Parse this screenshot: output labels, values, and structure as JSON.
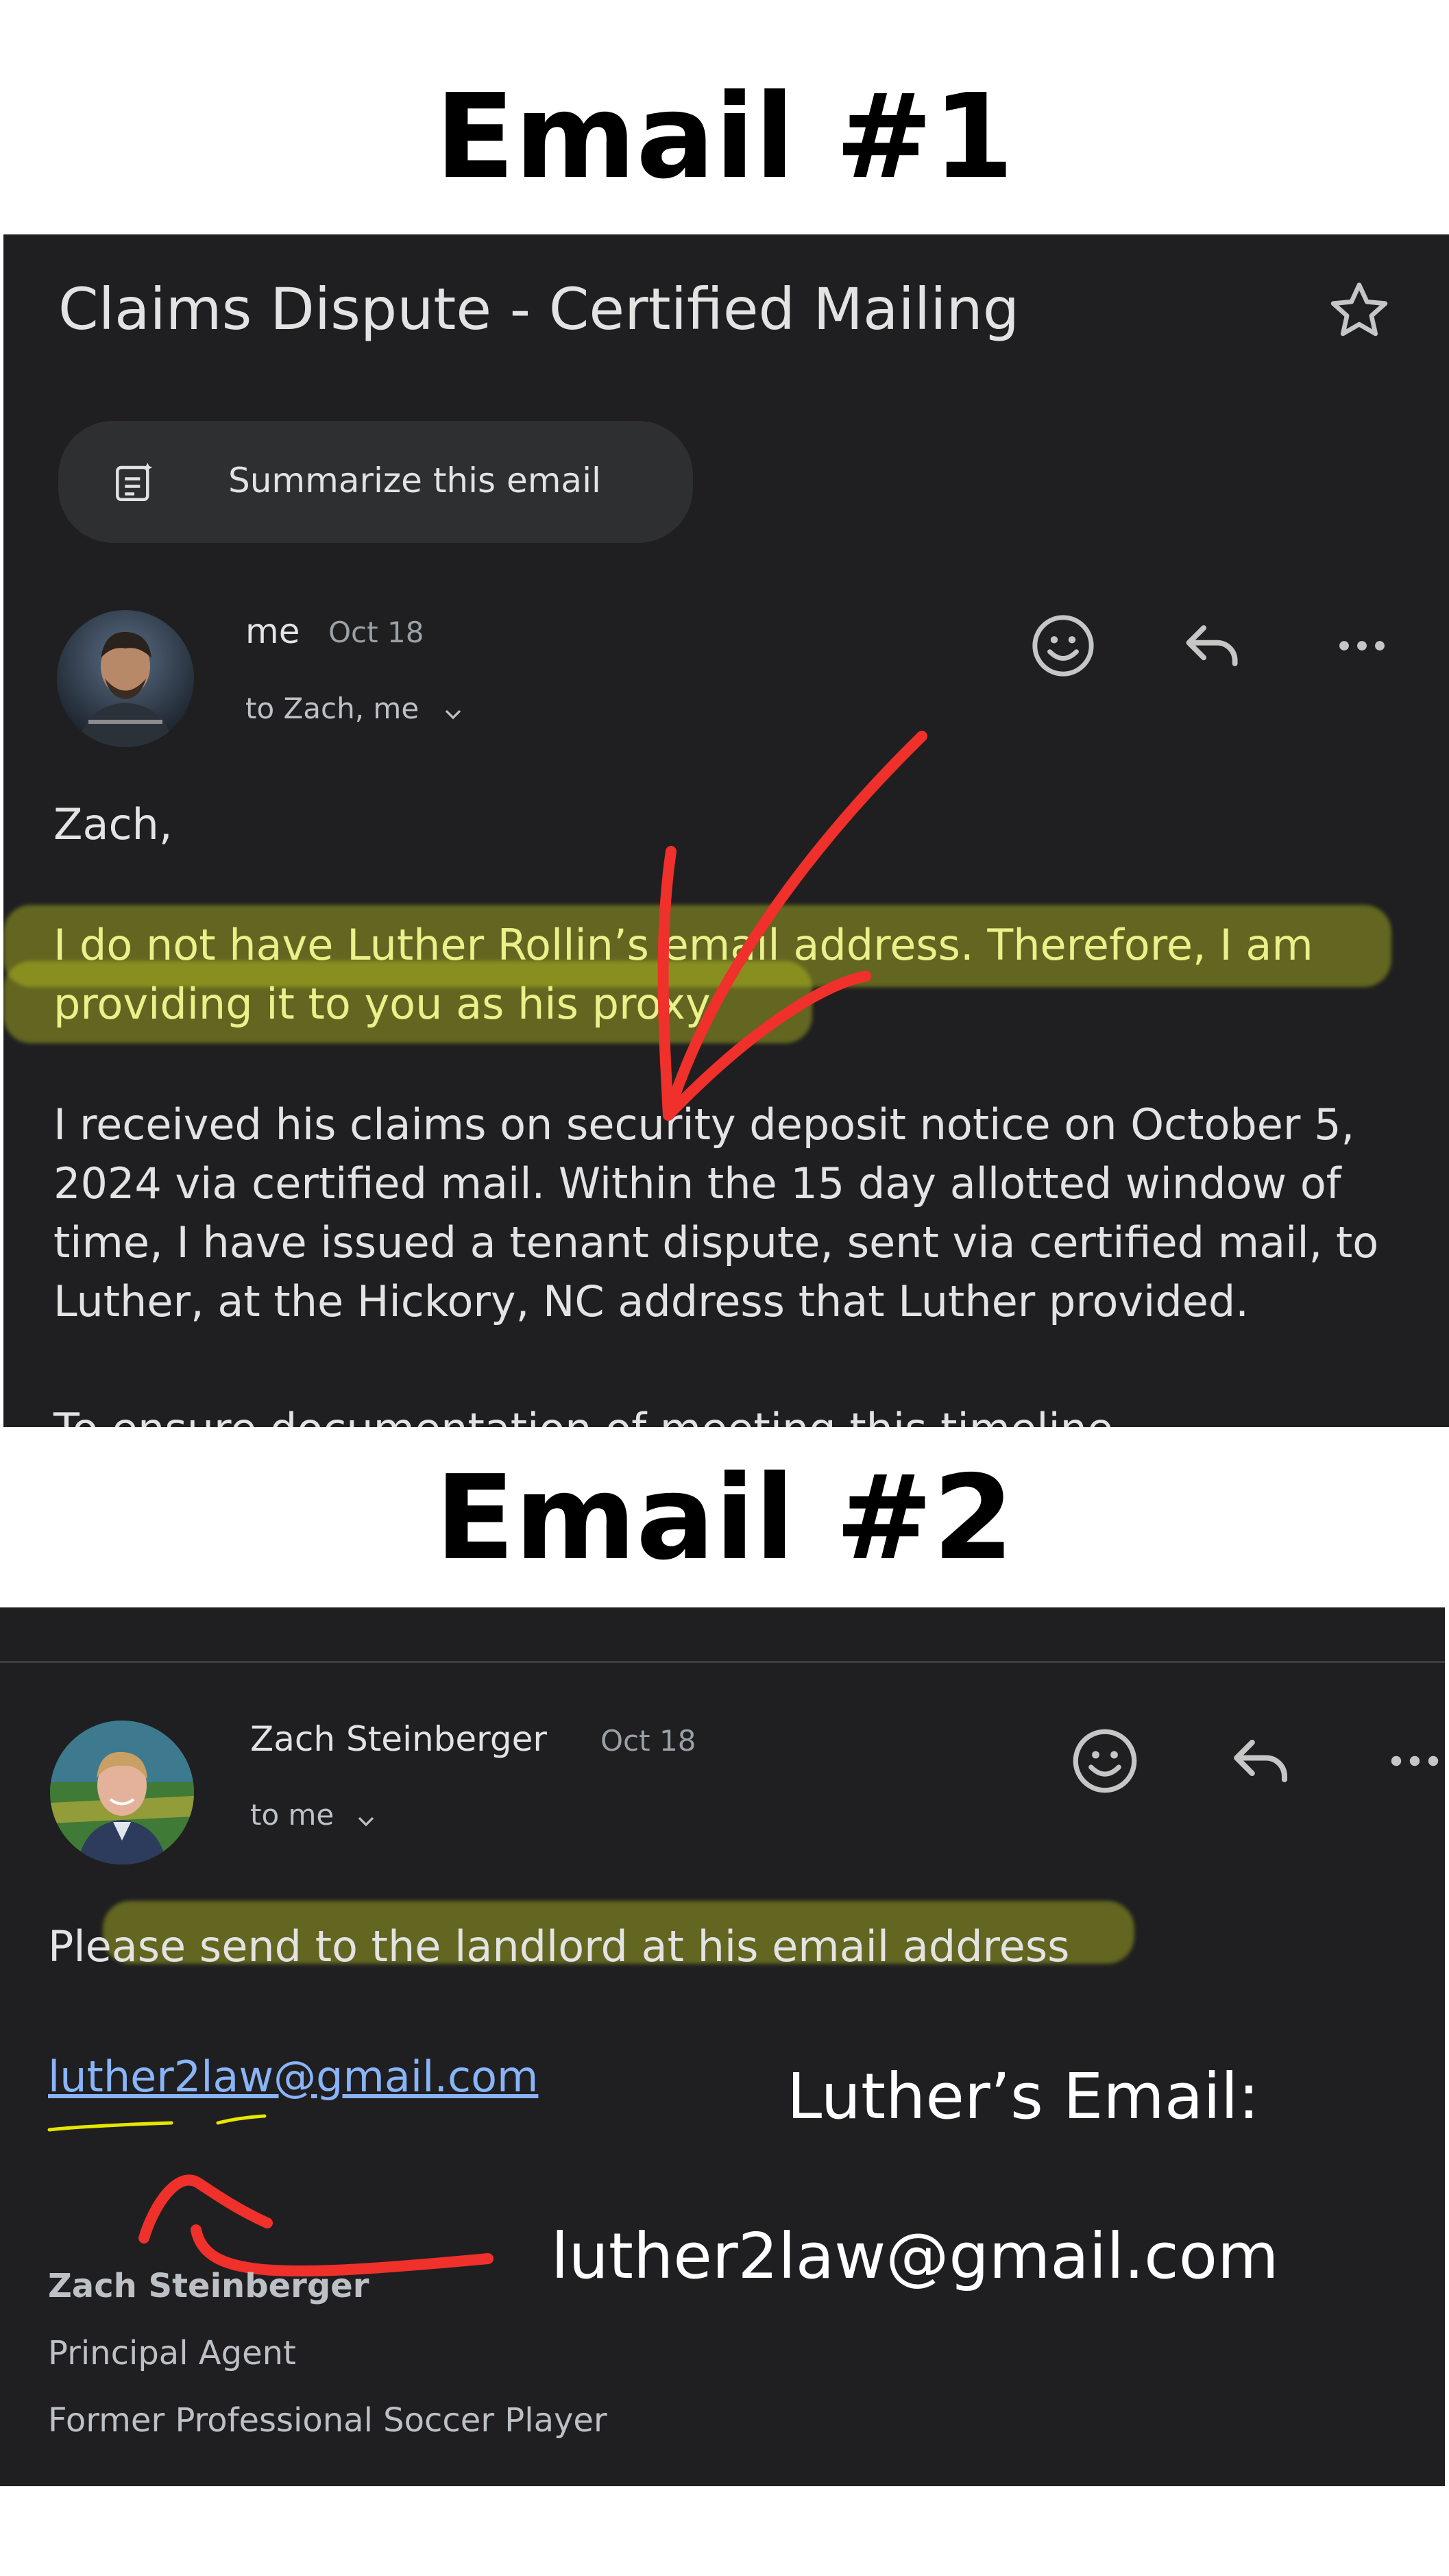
{
  "email1": {
    "heading": "Email #1",
    "subject": "Claims Dispute - Certified Mailing",
    "summarize_label": "Summarize this email",
    "sender": "me",
    "date": "Oct 18",
    "recipients": "to Zach, me",
    "greeting": "Zach,",
    "para1_line1": "I do not have Luther Rollin’s email address. Therefore, I am",
    "para1_line2": "providing it to you as his proxy.",
    "para2_line1": "I received his claims on security deposit notice on October 5,",
    "para2_line2": "2024 via certified mail. Within the 15 day allotted window of",
    "para2_line3": "time, I have issued a tenant dispute, sent via certified mail, to",
    "para2_line4": "Luther, at the Hickory, NC address that Luther provided.",
    "para3_partial": "To ensure documentation of meeting this timeline"
  },
  "email2": {
    "heading": "Email #2",
    "sender": "Zach Steinberger",
    "date": "Oct 18",
    "recipients": "to me",
    "body": "Please send to the landlord at his email address",
    "link": "luther2law@gmail.com",
    "callout_label": "Luther’s Email:",
    "callout_email": "luther2law@gmail.com",
    "signature": {
      "name": "Zach Steinberger",
      "title": "Principal Agent",
      "tagline": "Former Professional Soccer Player"
    }
  },
  "colors": {
    "panel_bg": "#1f1f21",
    "text": "#e3e3e3",
    "link": "#8ab4f8",
    "highlight": "#bec81e",
    "annotation_red": "#f0302a"
  },
  "icons": [
    "star-icon",
    "summarize-icon",
    "emoji-icon",
    "reply-icon",
    "more-icon",
    "chevron-down-icon"
  ]
}
